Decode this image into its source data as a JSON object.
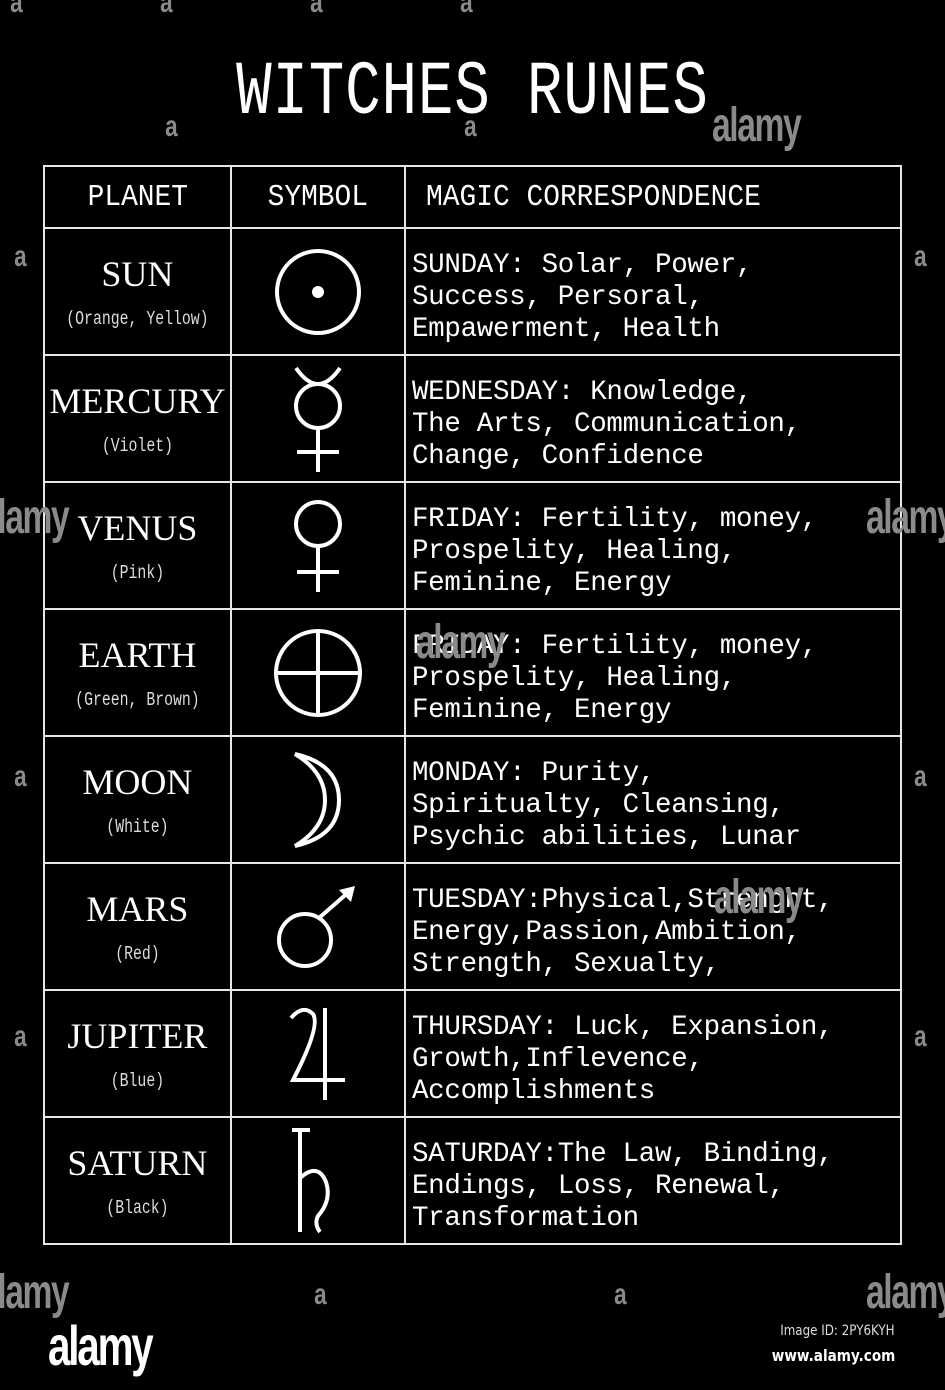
{
  "title": "WITCHES RUNES",
  "headers": {
    "planet": "PLANET",
    "symbol": "SYMBOL",
    "correspondence": "MAGIC CORRESPONDENCE"
  },
  "rows": [
    {
      "planet": "SUN",
      "colors": "(Orange, Yellow)",
      "symbol_icon": "sun-symbol-icon",
      "lines": [
        "SUNDAY: Solar, Power,",
        "Success, Persoral,",
        "Empawerment, Health"
      ]
    },
    {
      "planet": "MERCURY",
      "colors": "(Violet)",
      "symbol_icon": "mercury-symbol-icon",
      "lines": [
        "WEDNESDAY: Knowledge,",
        "The Arts, Communication,",
        "Change, Confidence"
      ]
    },
    {
      "planet": "VENUS",
      "colors": "(Pink)",
      "symbol_icon": "venus-symbol-icon",
      "lines": [
        "FRIDAY: Fertility, money,",
        "Prospelity, Healing,",
        "Feminine, Energy"
      ]
    },
    {
      "planet": "EARTH",
      "colors": "(Green, Brown)",
      "symbol_icon": "earth-symbol-icon",
      "lines": [
        "FRIDAY: Fertility, money,",
        "Prospelity, Healing,",
        "Feminine, Energy"
      ]
    },
    {
      "planet": "MOON",
      "colors": "(White)",
      "symbol_icon": "moon-symbol-icon",
      "lines": [
        "MONDAY: Purity,",
        "Spiritualty, Cleansing,",
        "Psychic abilities, Lunar"
      ]
    },
    {
      "planet": "MARS",
      "colors": "(Red)",
      "symbol_icon": "mars-symbol-icon",
      "lines": [
        "TUESDAY:Physical,Strenght,",
        "Energy,Passion,Ambition,",
        "Strength, Sexualty,"
      ]
    },
    {
      "planet": "JUPITER",
      "colors": "(Blue)",
      "symbol_icon": "jupiter-symbol-icon",
      "lines": [
        "THURSDAY: Luck, Expansion,",
        "Growth,Inflevence,",
        "Accomplishments"
      ]
    },
    {
      "planet": "SATURN",
      "colors": "(Black)",
      "symbol_icon": "saturn-symbol-icon",
      "lines": [
        "SATURDAY:The Law, Binding,",
        "Endings, Loss, Renewal,",
        "Transformation"
      ]
    }
  ],
  "watermark": {
    "small": "a",
    "big": "alamy",
    "logo": "alamy",
    "image_id": "Image ID: 2PY6KYH",
    "site": "www.alamy.com"
  }
}
